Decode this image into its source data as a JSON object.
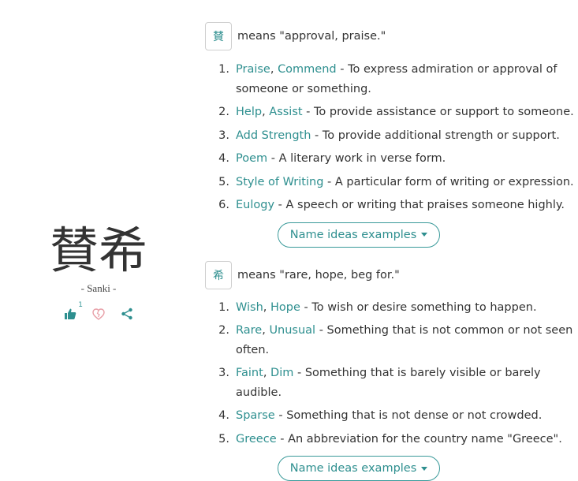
{
  "name": {
    "kanji": "賛希",
    "romaji": "- Sanki -",
    "like_count": "1"
  },
  "colors": {
    "accent": "#2e8f8f",
    "text": "#333333",
    "border": "#cfcfcf"
  },
  "sections": [
    {
      "kanji": "賛",
      "means": "means \"approval, praise.\"",
      "items": [
        {
          "num": "1.",
          "terms": [
            "Praise",
            "Commend"
          ],
          "desc": "To express admiration or approval of someone or something."
        },
        {
          "num": "2.",
          "terms": [
            "Help",
            "Assist"
          ],
          "desc": "To provide assistance or support to someone."
        },
        {
          "num": "3.",
          "terms": [
            "Add Strength"
          ],
          "desc": "To provide additional strength or support."
        },
        {
          "num": "4.",
          "terms": [
            "Poem"
          ],
          "desc": "A literary work in verse form."
        },
        {
          "num": "5.",
          "terms": [
            "Style of Writing"
          ],
          "desc": "A particular form of writing or expression."
        },
        {
          "num": "6.",
          "terms": [
            "Eulogy"
          ],
          "desc": "A speech or writing that praises someone highly."
        }
      ],
      "button_label": "Name ideas examples"
    },
    {
      "kanji": "希",
      "means": "means \"rare, hope, beg for.\"",
      "items": [
        {
          "num": "1.",
          "terms": [
            "Wish",
            "Hope"
          ],
          "desc": "To wish or desire something to happen."
        },
        {
          "num": "2.",
          "terms": [
            "Rare",
            "Unusual"
          ],
          "desc": "Something that is not common or not seen often."
        },
        {
          "num": "3.",
          "terms": [
            "Faint",
            "Dim"
          ],
          "desc": "Something that is barely visible or barely audible."
        },
        {
          "num": "4.",
          "terms": [
            "Sparse"
          ],
          "desc": "Something that is not dense or not crowded."
        },
        {
          "num": "5.",
          "terms": [
            "Greece"
          ],
          "desc": "An abbreviation for the country name \"Greece\"."
        }
      ],
      "button_label": "Name ideas examples"
    }
  ]
}
